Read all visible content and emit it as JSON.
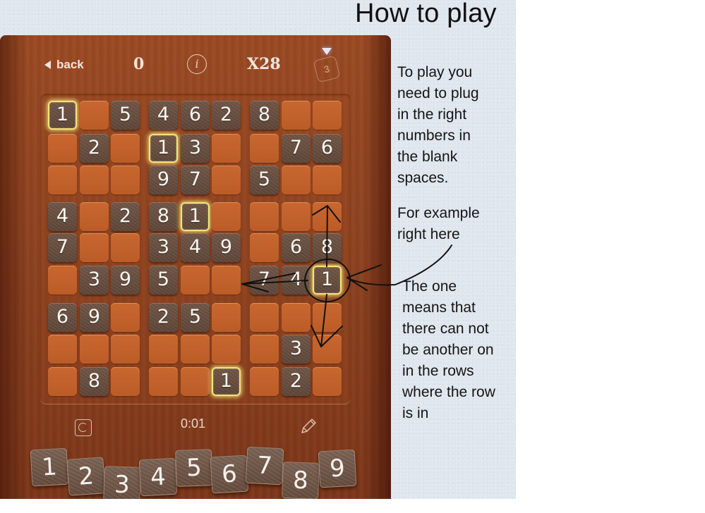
{
  "page": {
    "title": "How to play"
  },
  "game": {
    "topbar": {
      "back_label": "back",
      "score": "0",
      "info_label": "i",
      "multiplier": "X28",
      "hint_count": "3"
    },
    "grid": [
      [
        "1",
        "",
        "5",
        "4",
        "6",
        "2",
        "8",
        "",
        ""
      ],
      [
        "",
        "2",
        "",
        "1",
        "3",
        "",
        "",
        "7",
        "6"
      ],
      [
        "",
        "",
        "",
        "9",
        "7",
        "",
        "5",
        "",
        ""
      ],
      [
        "4",
        "",
        "2",
        "8",
        "1",
        "",
        "",
        "",
        ""
      ],
      [
        "7",
        "",
        "",
        "3",
        "4",
        "9",
        "",
        "6",
        "8"
      ],
      [
        "",
        "3",
        "9",
        "5",
        "",
        "",
        "7",
        "4",
        "1"
      ],
      [
        "6",
        "9",
        "",
        "2",
        "5",
        "",
        "",
        "",
        ""
      ],
      [
        "",
        "",
        "",
        "",
        "",
        "",
        "",
        "3",
        ""
      ],
      [
        "",
        "8",
        "",
        "",
        "",
        "1",
        "",
        "2",
        ""
      ]
    ],
    "highlighted_cells": [
      [
        0,
        0
      ],
      [
        1,
        3
      ],
      [
        3,
        4
      ],
      [
        5,
        8
      ],
      [
        8,
        5
      ]
    ],
    "timer": "0:01",
    "number_tiles": [
      "1",
      "2",
      "3",
      "4",
      "5",
      "6",
      "7",
      "8",
      "9"
    ]
  },
  "instructions": {
    "paragraph1": [
      "To play you",
      "need to plug",
      "in the right",
      "numbers in",
      "the blank",
      "spaces."
    ],
    "paragraph2": [
      "For example",
      "right here"
    ],
    "paragraph3": [
      "The one",
      "means that",
      "there can not",
      "be another on",
      "in the rows",
      "where the row",
      "is in"
    ]
  },
  "colors": {
    "wood": "#8f4320",
    "empty_cell": "#c8672f",
    "filled_cell": "#654c3e",
    "highlight": "#f3e47a",
    "paper": "#dfe6ee",
    "ink": "#111111"
  }
}
